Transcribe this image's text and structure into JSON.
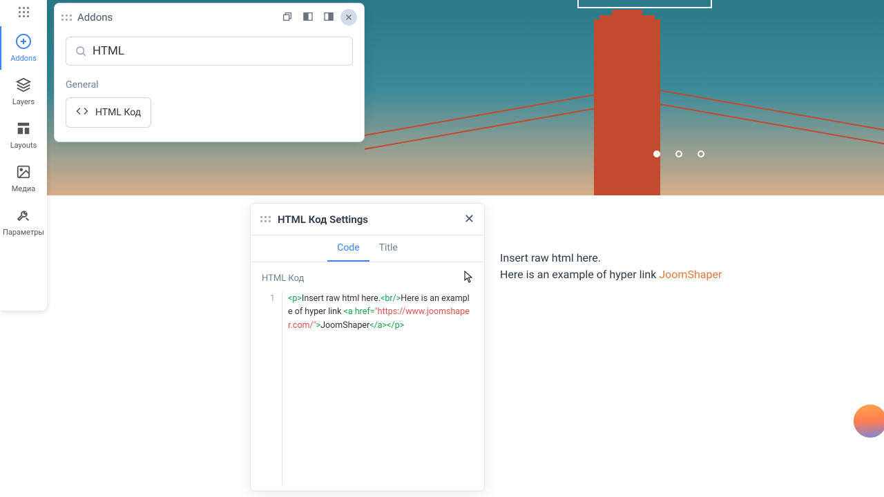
{
  "sidebar": {
    "items": [
      {
        "id": "addons",
        "label": "Addons"
      },
      {
        "id": "layers",
        "label": "Layers"
      },
      {
        "id": "layouts",
        "label": "Layouts"
      },
      {
        "id": "media",
        "label": "Медиа"
      },
      {
        "id": "params",
        "label": "Параметры"
      }
    ]
  },
  "addons_panel": {
    "title": "Addons",
    "search_value": "HTML",
    "section": "General",
    "addon_item": "HTML Код"
  },
  "settings_panel": {
    "title": "HTML Код Settings",
    "tabs": {
      "code": "Code",
      "title": "Title"
    },
    "field_label": "HTML Код",
    "gutter": "1",
    "code_tokens": {
      "t1": "<p>",
      "t2": "Insert raw html here.",
      "t3": "<br/>",
      "t4": "Here is an example of hyper link ",
      "t5": "<a href=",
      "t6": "\"https://www.joomshaper.com/\"",
      "t7": ">",
      "t8": "JoomShaper",
      "t9": "</a></p>"
    }
  },
  "preview": {
    "line1": "Insert raw html here.",
    "line2_prefix": "Here is an example of hyper link ",
    "link_text": "JoomShaper"
  }
}
